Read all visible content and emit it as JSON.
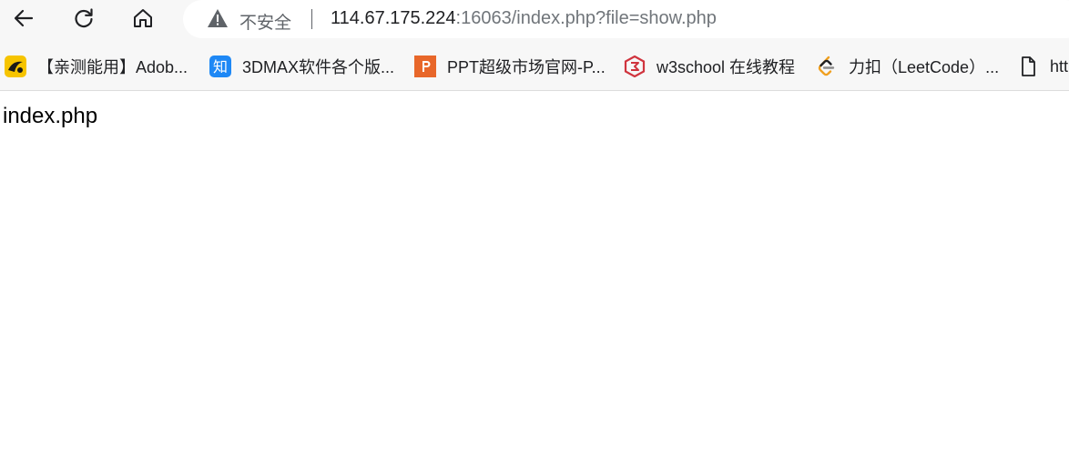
{
  "nav": {
    "back_icon": "arrow-left-icon",
    "reload_icon": "reload-icon",
    "home_icon": "home-icon"
  },
  "address_bar": {
    "security_label": "不安全",
    "url_host": "114.67.175.224",
    "url_rest": ":16063/index.php?file=show.php"
  },
  "bookmarks": [
    {
      "label": "【亲测能用】Adob...",
      "icon": "yellow-logo-icon"
    },
    {
      "label": "3DMAX软件各个版...",
      "icon": "zhihu-icon"
    },
    {
      "label": "PPT超级市场官网-P...",
      "icon": "ppt-market-icon"
    },
    {
      "label": "w3school 在线教程",
      "icon": "w3school-icon"
    },
    {
      "label": "力扣（LeetCode）...",
      "icon": "leetcode-icon"
    },
    {
      "label": "htt",
      "icon": "page-icon"
    }
  ],
  "page": {
    "body_text": "index.php"
  },
  "colors": {
    "toolbar_bg": "#f7f7f7",
    "zhihu_blue": "#1e88f5",
    "ppt_orange": "#e8672a",
    "w3school_red": "#d0343e",
    "leetcode_orange": "#f0a020"
  }
}
